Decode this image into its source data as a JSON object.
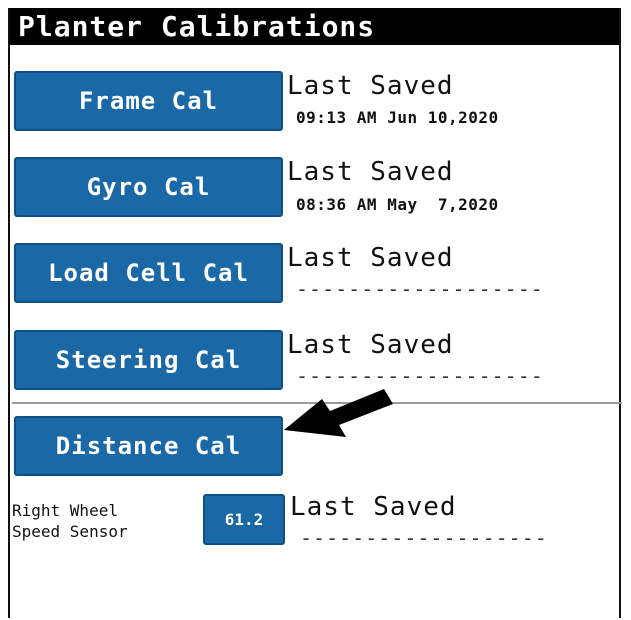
{
  "title": "Planter Calibrations",
  "calibrations": [
    {
      "label": "Frame Cal",
      "saved_label": "Last Saved",
      "saved_value": "09:13 AM Jun 10,2020"
    },
    {
      "label": "Gyro Cal",
      "saved_label": "Last Saved",
      "saved_value": "08:36 AM May  7,2020"
    },
    {
      "label": "Load Cell Cal",
      "saved_label": "Last Saved",
      "saved_value": "-------------------"
    },
    {
      "label": "Steering Cal",
      "saved_label": "Last Saved",
      "saved_value": "-------------------"
    }
  ],
  "distance": {
    "label": "Distance Cal",
    "sensor_label_line1": "Right Wheel",
    "sensor_label_line2": "Speed Sensor",
    "sensor_value": "61.2",
    "saved_label": "Last Saved",
    "saved_value": "-------------------"
  },
  "colors": {
    "button_blue": "#1b68a6",
    "title_bg": "#000000"
  },
  "annotation": {
    "icon": "arrow-pointer-icon"
  }
}
